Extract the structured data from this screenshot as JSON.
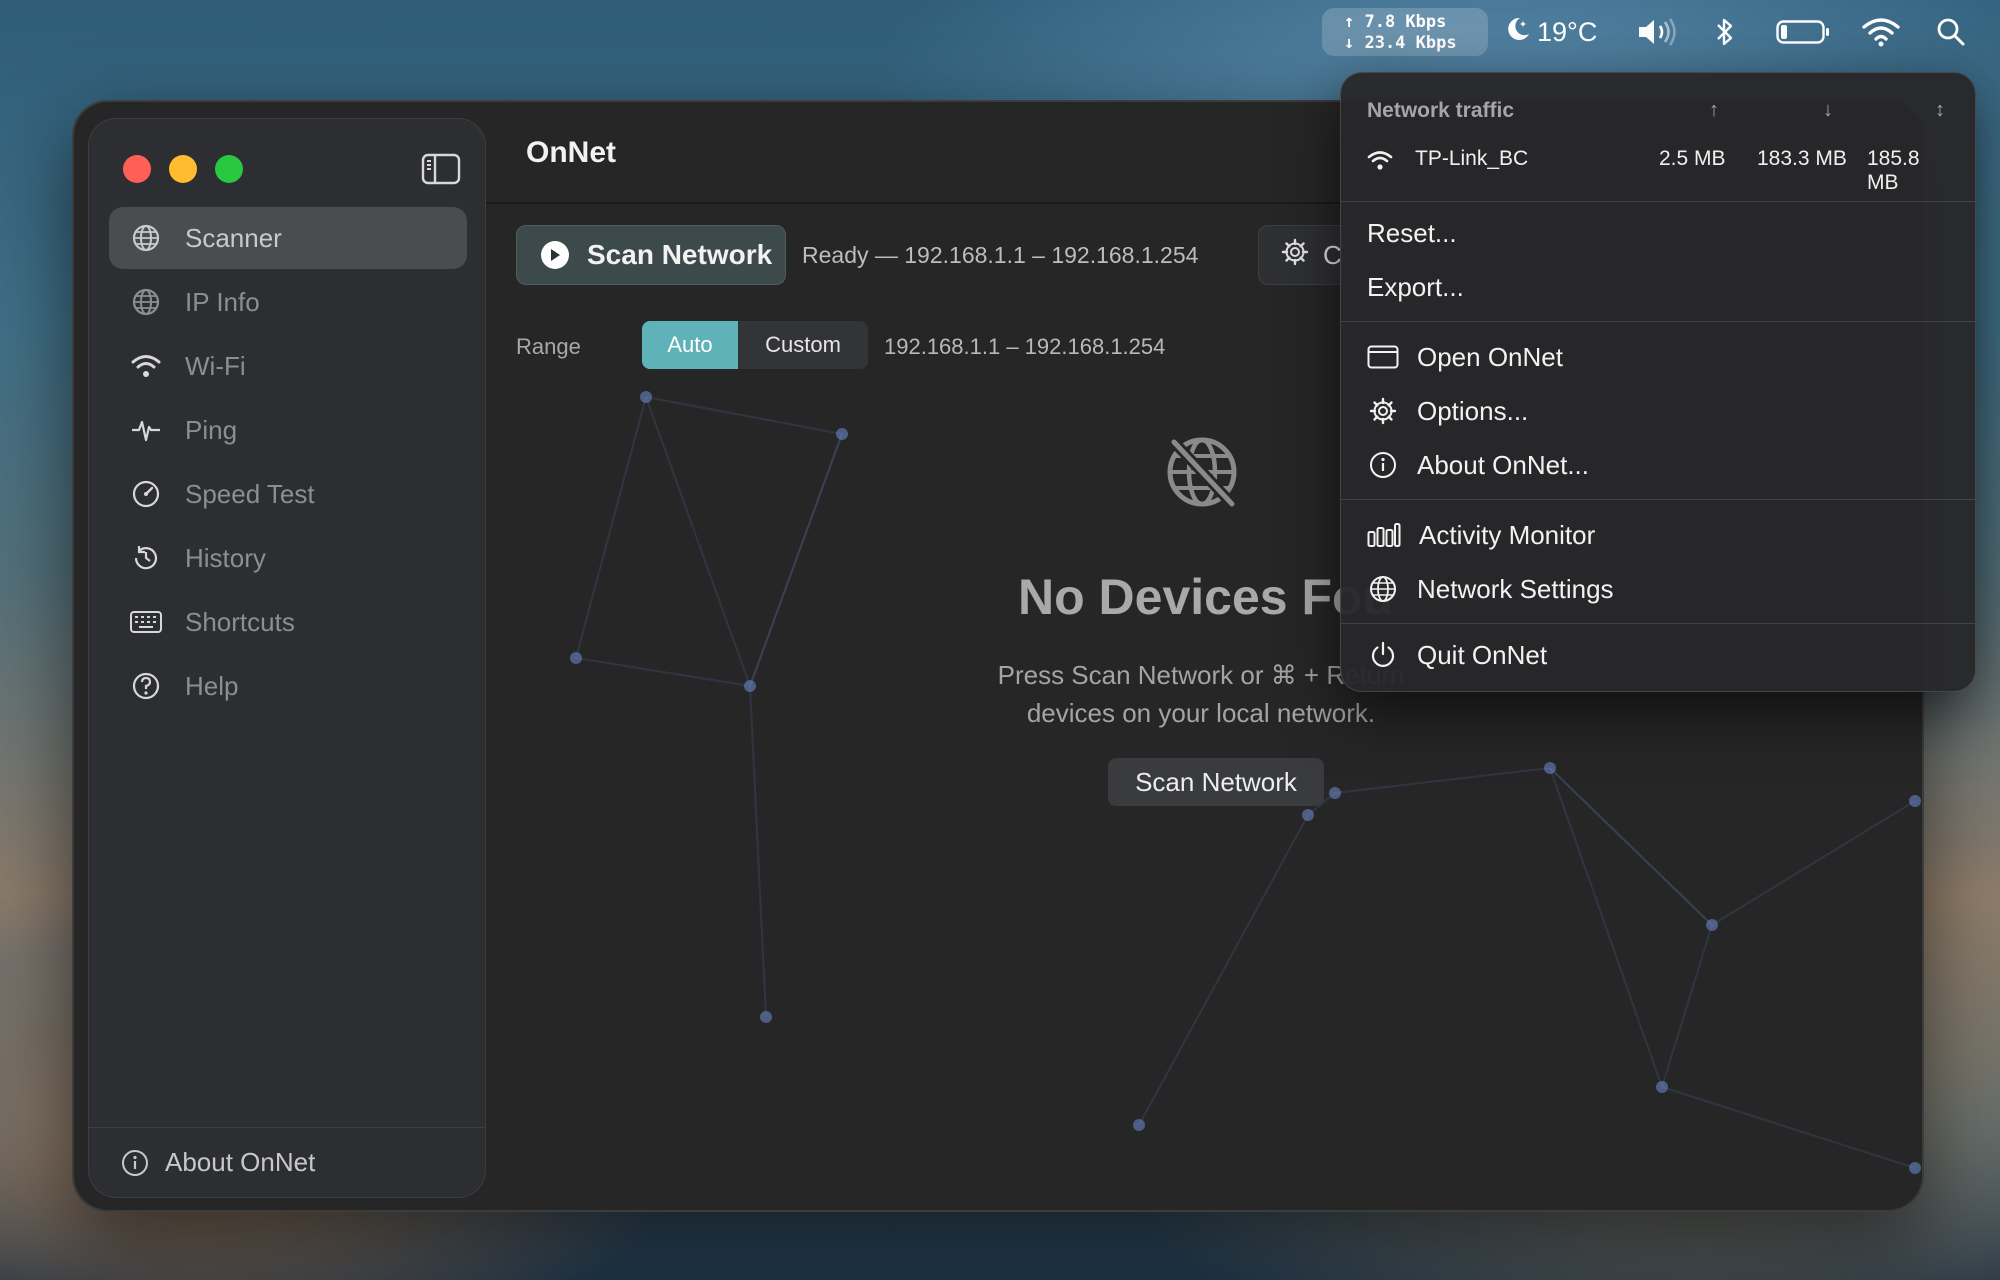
{
  "menubar": {
    "upload_speed": "↑ 7.8 Kbps",
    "download_speed": "↓ 23.4 Kbps",
    "temperature": "19°C",
    "icons": [
      "moon-icon",
      "volume-icon",
      "bluetooth-icon",
      "battery-icon",
      "wifi-icon",
      "search-icon"
    ]
  },
  "window": {
    "title": "OnNet",
    "sidebar": {
      "items": [
        {
          "label": "Scanner",
          "icon": "scanner-globe-icon",
          "active": true
        },
        {
          "label": "IP Info",
          "icon": "globe-icon"
        },
        {
          "label": "Wi-Fi",
          "icon": "wifi-icon"
        },
        {
          "label": "Ping",
          "icon": "pulse-icon"
        },
        {
          "label": "Speed Test",
          "icon": "speedometer-icon"
        },
        {
          "label": "History",
          "icon": "history-icon"
        },
        {
          "label": "Shortcuts",
          "icon": "keyboard-icon"
        },
        {
          "label": "Help",
          "icon": "help-icon"
        }
      ],
      "footer": "About OnNet"
    },
    "toolbar": {
      "scan_label": "Scan Network",
      "status": "Ready — 192.168.1.1 – 192.168.1.254",
      "options_label": "C"
    },
    "range": {
      "label": "Range",
      "options": [
        "Auto",
        "Custom"
      ],
      "selected": "Auto",
      "value": "192.168.1.1 – 192.168.1.254"
    },
    "empty_state": {
      "title": "No Devices Fou",
      "description_line1": "Press Scan Network or ⌘ + Return",
      "description_line2": "devices on your local network.",
      "button": "Scan Network"
    }
  },
  "menu": {
    "traffic_header": "Network traffic",
    "traffic_columns": [
      "↑",
      "↓",
      "↕"
    ],
    "traffic_row": {
      "network": "TP-Link_BC",
      "upload": "2.5 MB",
      "download": "183.3 MB",
      "total": "185.8 MB"
    },
    "items_group1": [
      "Reset...",
      "Export..."
    ],
    "items_group2": [
      {
        "label": "Open OnNet",
        "icon": "window-icon"
      },
      {
        "label": "Options...",
        "icon": "gear-icon"
      },
      {
        "label": "About OnNet...",
        "icon": "info-icon"
      }
    ],
    "items_group3": [
      {
        "label": "Activity Monitor",
        "icon": "activity-monitor-icon"
      },
      {
        "label": "Network Settings",
        "icon": "network-globe-icon"
      }
    ],
    "quit": {
      "label": "Quit OnNet",
      "icon": "power-icon"
    }
  },
  "colors": {
    "accent": "#5fb3b8",
    "close": "#ff5f57",
    "minimize": "#febc2e",
    "maximize": "#28c840"
  }
}
